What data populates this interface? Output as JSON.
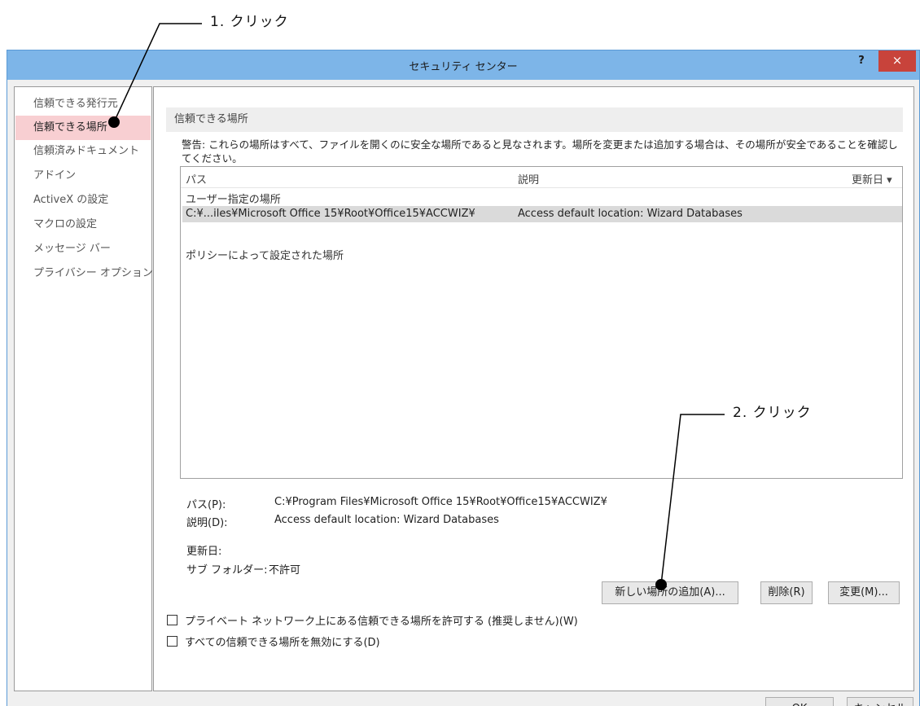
{
  "annotations": {
    "step1": "1. クリック",
    "step2": "2. クリック"
  },
  "window": {
    "title": "セキュリティ センター",
    "help": "?",
    "close": "×"
  },
  "sidebar": {
    "items": [
      {
        "label": "信頼できる発行元"
      },
      {
        "label": "信頼できる場所"
      },
      {
        "label": "信頼済みドキュメント"
      },
      {
        "label": "アドイン"
      },
      {
        "label": "ActiveX の設定"
      },
      {
        "label": "マクロの設定"
      },
      {
        "label": "メッセージ バー"
      },
      {
        "label": "プライバシー オプション"
      }
    ]
  },
  "main": {
    "section_title": "信頼できる場所",
    "warning": "警告: これらの場所はすべて、ファイルを開くのに安全な場所であると見なされます。場所を変更または追加する場合は、その場所が安全であることを確認してください。",
    "columns": {
      "path": "パス",
      "description": "説明",
      "modified": "更新日 ▾"
    },
    "group_user": "ユーザー指定の場所",
    "rows": [
      {
        "path": "C:¥...iles¥Microsoft Office 15¥Root¥Office15¥ACCWIZ¥",
        "description": "Access default location: Wizard Databases"
      }
    ],
    "group_policy": "ポリシーによって設定された場所",
    "details": {
      "path_label": "パス(P):",
      "path_value": "C:¥Program Files¥Microsoft Office 15¥Root¥Office15¥ACCWIZ¥",
      "desc_label": "説明(D):",
      "desc_value": "Access default location: Wizard Databases",
      "modified_label": "更新日:",
      "subfolder_label": "サブ フォルダー:",
      "subfolder_value": "不許可"
    },
    "buttons": {
      "add": "新しい場所の追加(A)...",
      "remove": "削除(R)",
      "modify": "変更(M)..."
    },
    "checkboxes": [
      {
        "label": "プライベート ネットワーク上にある信頼できる場所を許可する (推奨しません)(W)",
        "checked": false
      },
      {
        "label": "すべての信頼できる場所を無効にする(D)",
        "checked": false
      }
    ]
  },
  "footer": {
    "ok": "OK",
    "cancel": "キャンセル"
  }
}
